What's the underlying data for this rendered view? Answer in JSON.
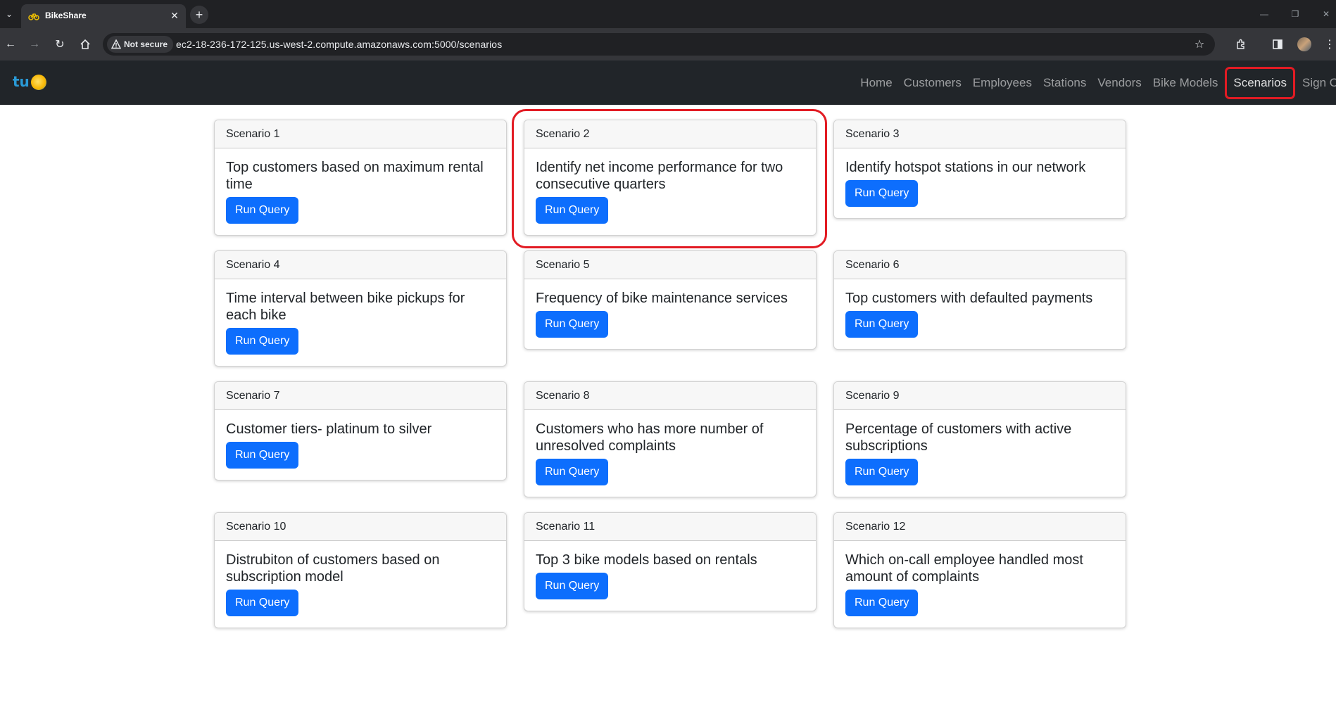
{
  "browser": {
    "tab_title": "BikeShare",
    "new_tab_symbol": "+",
    "security_label": "Not secure",
    "url": "ec2-18-236-172-125.us-west-2.compute.amazonaws.com:5000/scenarios"
  },
  "navbar": {
    "brand": "tu",
    "links": [
      "Home",
      "Customers",
      "Employees",
      "Stations",
      "Vendors",
      "Bike Models",
      "Scenarios",
      "Sign Ou"
    ],
    "active": "Scenarios"
  },
  "scenarios": [
    {
      "header": "Scenario 1",
      "title": "Top customers based on maximum rental time",
      "button": "Run Query"
    },
    {
      "header": "Scenario 2",
      "title": "Identify net income performance for two consecutive quarters",
      "button": "Run Query"
    },
    {
      "header": "Scenario 3",
      "title": "Identify hotspot stations in our network",
      "button": "Run Query"
    },
    {
      "header": "Scenario 4",
      "title": "Time interval between bike pickups for each bike",
      "button": "Run Query"
    },
    {
      "header": "Scenario 5",
      "title": "Frequency of bike maintenance services",
      "button": "Run Query"
    },
    {
      "header": "Scenario 6",
      "title": "Top customers with defaulted payments",
      "button": "Run Query"
    },
    {
      "header": "Scenario 7",
      "title": "Customer tiers- platinum to silver",
      "button": "Run Query"
    },
    {
      "header": "Scenario 8",
      "title": "Customers who has more number of unresolved complaints",
      "button": "Run Query"
    },
    {
      "header": "Scenario 9",
      "title": "Percentage of customers with active subscriptions",
      "button": "Run Query"
    },
    {
      "header": "Scenario 10",
      "title": "Distrubiton of customers based on subscription model",
      "button": "Run Query"
    },
    {
      "header": "Scenario 11",
      "title": "Top 3 bike models based on rentals",
      "button": "Run Query"
    },
    {
      "header": "Scenario 12",
      "title": "Which on-call employee handled most amount of complaints",
      "button": "Run Query"
    }
  ],
  "colors": {
    "navbar_bg": "#212529",
    "primary_button": "#0d6efd",
    "highlight": "#e21b23"
  }
}
